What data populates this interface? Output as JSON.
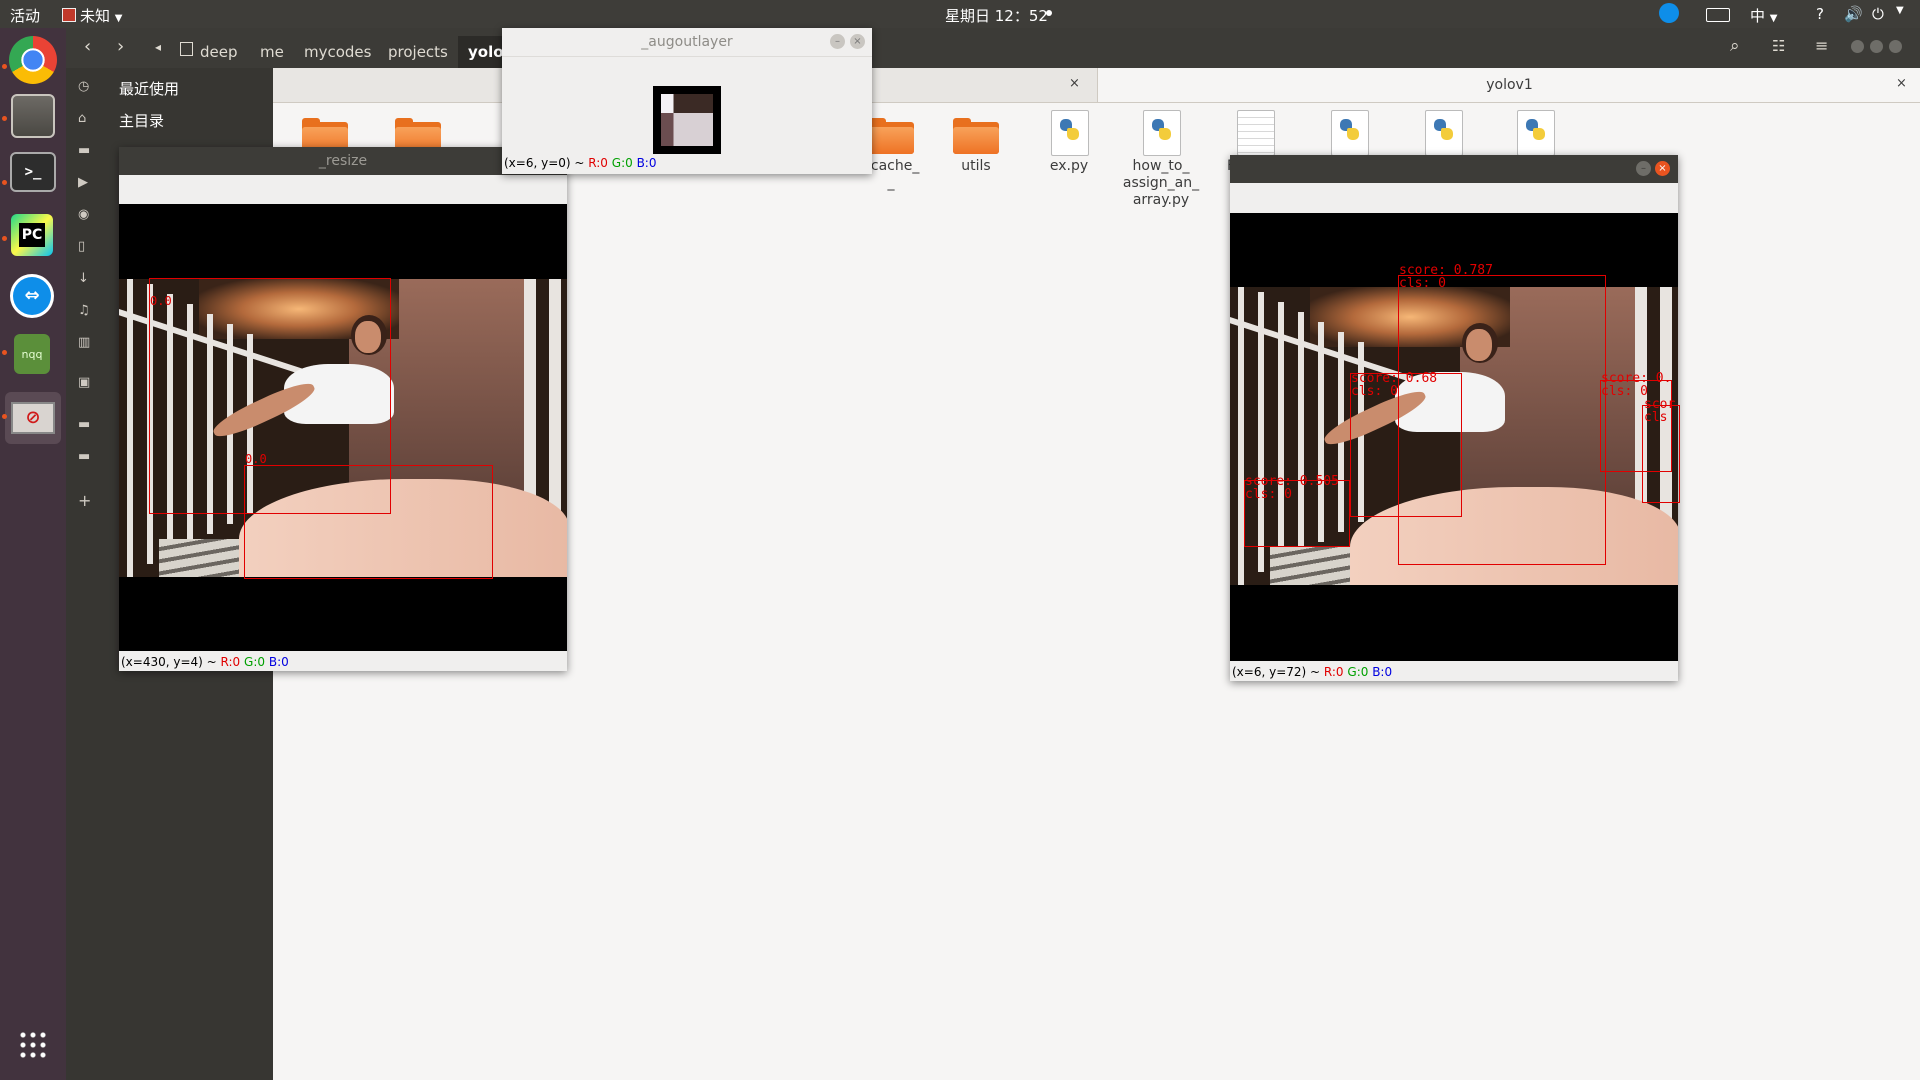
{
  "topbar": {
    "activities": "活动",
    "app_name": "未知",
    "clock": "星期日 12：52",
    "input_method": "中"
  },
  "dock": {
    "items": [
      "chrome-icon",
      "files-icon",
      "terminal-icon",
      "pycharm-icon",
      "teamviewer-icon",
      "nqq-icon",
      "blocked-app-icon"
    ],
    "nqq_label": "nqq",
    "pycharm_label": "PC"
  },
  "files": {
    "breadcrumbs": [
      "deep",
      "me",
      "mycodes",
      "projects",
      "yolo"
    ],
    "sidebar": {
      "recent": "最近使用",
      "home": "主目录"
    },
    "tabs": [
      {
        "label": ""
      },
      {
        "label": "yolov1"
      }
    ],
    "items": [
      {
        "label": "ycache_\n_"
      },
      {
        "label": "utils"
      },
      {
        "label": "ex.py"
      },
      {
        "label": "how_to_\nassign_an_\narray.py"
      },
      {
        "label": "F"
      }
    ]
  },
  "windows": {
    "resize": {
      "title": "_resize",
      "status": {
        "coords": "(x=430, y=4) ~",
        "r": "R:0",
        "g": "G:0",
        "b": "B:0"
      },
      "detections": [
        {
          "label": "0.0"
        },
        {
          "label": "0.0"
        }
      ]
    },
    "augoutlayer": {
      "title": "_augoutlayer",
      "status": {
        "coords": "(x=6, y=0) ~",
        "r": "R:0",
        "g": "G:0",
        "b": "B:0"
      }
    },
    "result": {
      "status": {
        "coords": "(x=6, y=72) ~",
        "r": "R:0",
        "g": "G:0",
        "b": "B:0"
      },
      "detections": [
        {
          "score": "score: 0.787",
          "cls": "cls: 0"
        },
        {
          "score": "score: 0.68",
          "cls": "cls: 0"
        },
        {
          "score": "score: 0.505",
          "cls": "cls: 0"
        },
        {
          "score": "score: 0.",
          "cls": "cls: 0"
        },
        {
          "score": "scor",
          "cls": "cls"
        }
      ]
    }
  },
  "colors": {
    "box": "#e10000",
    "accent": "#e95420",
    "dock_bg": "#42333e"
  }
}
